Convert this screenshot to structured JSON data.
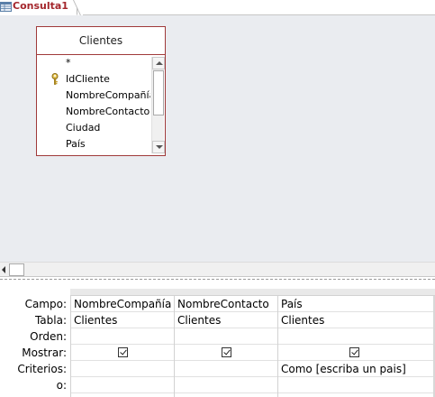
{
  "tab": {
    "label": "Consulta1"
  },
  "table": {
    "name": "Clientes",
    "fields": [
      {
        "label": "*",
        "key": false
      },
      {
        "label": "IdCliente",
        "key": true
      },
      {
        "label": "NombreCompañía",
        "key": false
      },
      {
        "label": "NombreContacto",
        "key": false
      },
      {
        "label": "Ciudad",
        "key": false
      },
      {
        "label": "País",
        "key": false
      }
    ]
  },
  "grid": {
    "row_labels": [
      "Campo:",
      "Tabla:",
      "Orden:",
      "Mostrar:",
      "Criterios:",
      "o:"
    ],
    "columns": [
      {
        "campo": "NombreCompañía",
        "tabla": "Clientes",
        "orden": "",
        "mostrar": true,
        "criterios": "",
        "o": ""
      },
      {
        "campo": "NombreContacto",
        "tabla": "Clientes",
        "orden": "",
        "mostrar": true,
        "criterios": "",
        "o": ""
      },
      {
        "campo": "País",
        "tabla": "Clientes",
        "orden": "",
        "mostrar": true,
        "criterios": "Como [escriba un pais]",
        "o": ""
      }
    ]
  },
  "colors": {
    "accent": "#a4262c",
    "design_background": "#eaecf0",
    "field_list_border": "#a03a3a"
  }
}
